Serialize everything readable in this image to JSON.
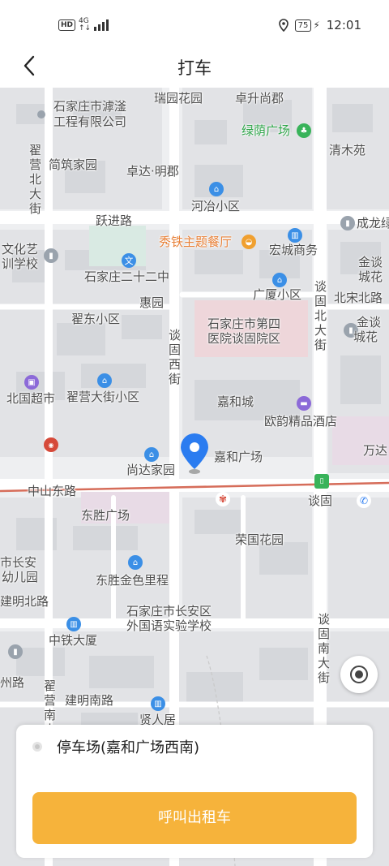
{
  "status_bar": {
    "hd": "HD",
    "network": "4G",
    "battery": "75",
    "time": "12:01"
  },
  "header": {
    "title": "打车"
  },
  "map": {
    "labels": {
      "ruiyuan": "瑞园花园",
      "zhuosheng": "卓升尚郡",
      "lianyi_school": "石家庄市滹滏",
      "lianyi_school2": "工程有限公司",
      "lvyin": "绿荫广场",
      "zhaiying_north": "翟营北大街",
      "jianzhu": "简筑家园",
      "zhuoda": "卓达·明郡",
      "qingmu": "清木苑",
      "heye": "河冶小区",
      "yuejin": "跃进路",
      "chenglong": "成龙绿",
      "wenhua": "文化艺",
      "wenhua2": "训学校",
      "xiutie": "秀铁主题餐厅",
      "hongcheng": "宏城商务",
      "jintan": "金谈",
      "jintan2": "城花",
      "school22": "石家庄二十二中",
      "guangsha": "广厦小区",
      "beisong": "北宋北路",
      "huiyuan": "惠园",
      "zhaidong": "翟东小区",
      "tangu_north": "谈固北大街",
      "hospital": "石家庄市第四",
      "hospital2": "医院谈固院区",
      "jingu": "金谈",
      "jingu2": "城花",
      "tangu_west": "谈固西街",
      "beiguo": "北国超市",
      "zhaiying_street": "翟营大街小区",
      "jiahe_city": "嘉和城",
      "ouyun": "欧韵精品酒店",
      "wanda": "万达",
      "shangda": "尚达家园",
      "jiahe_square": "嘉和广场",
      "zhongshan": "中山东路",
      "tangu": "谈固",
      "dongsheng_square": "东胜广场",
      "rongguo": "荣国花园",
      "changan_kg": "市长安",
      "changan_kg2": "幼儿园",
      "dongsheng_jinse": "东胜金色里程",
      "jianming_north": "建明北路",
      "foreign_school": "石家庄市长安区",
      "foreign_school2": "外国语实验学校",
      "zhongtie": "中铁大厦",
      "tangu_south": "谈固南大街",
      "zhou_road": "州路",
      "zhaiying_south": "翟营南大",
      "jianming_south": "建明南路",
      "xianren": "贤人居"
    },
    "poi_icons": {
      "culture": "文"
    }
  },
  "pickup": {
    "location": "停车场(嘉和广场西南)"
  },
  "actions": {
    "call_taxi": "呼叫出租车"
  },
  "colors": {
    "accent": "#f6b33b",
    "pin": "#2b7cf0",
    "railway": "#d66d5a"
  }
}
